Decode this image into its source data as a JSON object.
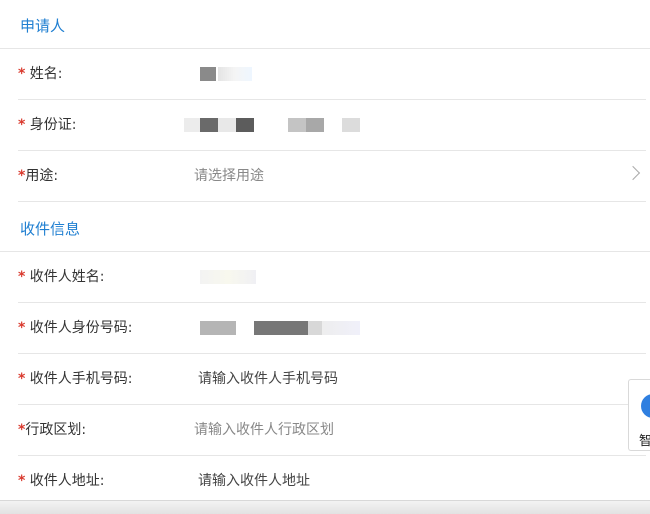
{
  "applicant": {
    "section_title": "申请人",
    "name_label": "姓名:",
    "id_label": "身份证:",
    "purpose_label": "用途:",
    "purpose_placeholder": "请选择用途"
  },
  "recipient": {
    "section_title": "收件信息",
    "name_label": "收件人姓名:",
    "id_label": "收件人身份号码:",
    "phone_label": "收件人手机号码:",
    "phone_placeholder": "请输入收件人手机号码",
    "region_label": "行政区划:",
    "region_placeholder": "请输入收件人行政区划",
    "address_label": "收件人地址:",
    "address_placeholder": "请输入收件人地址"
  },
  "required_mark": "*",
  "float_widget": {
    "label": "智"
  },
  "colors": {
    "accent": "#1f7fd1",
    "required": "#d93a2e",
    "divider": "#e6e6e6"
  }
}
